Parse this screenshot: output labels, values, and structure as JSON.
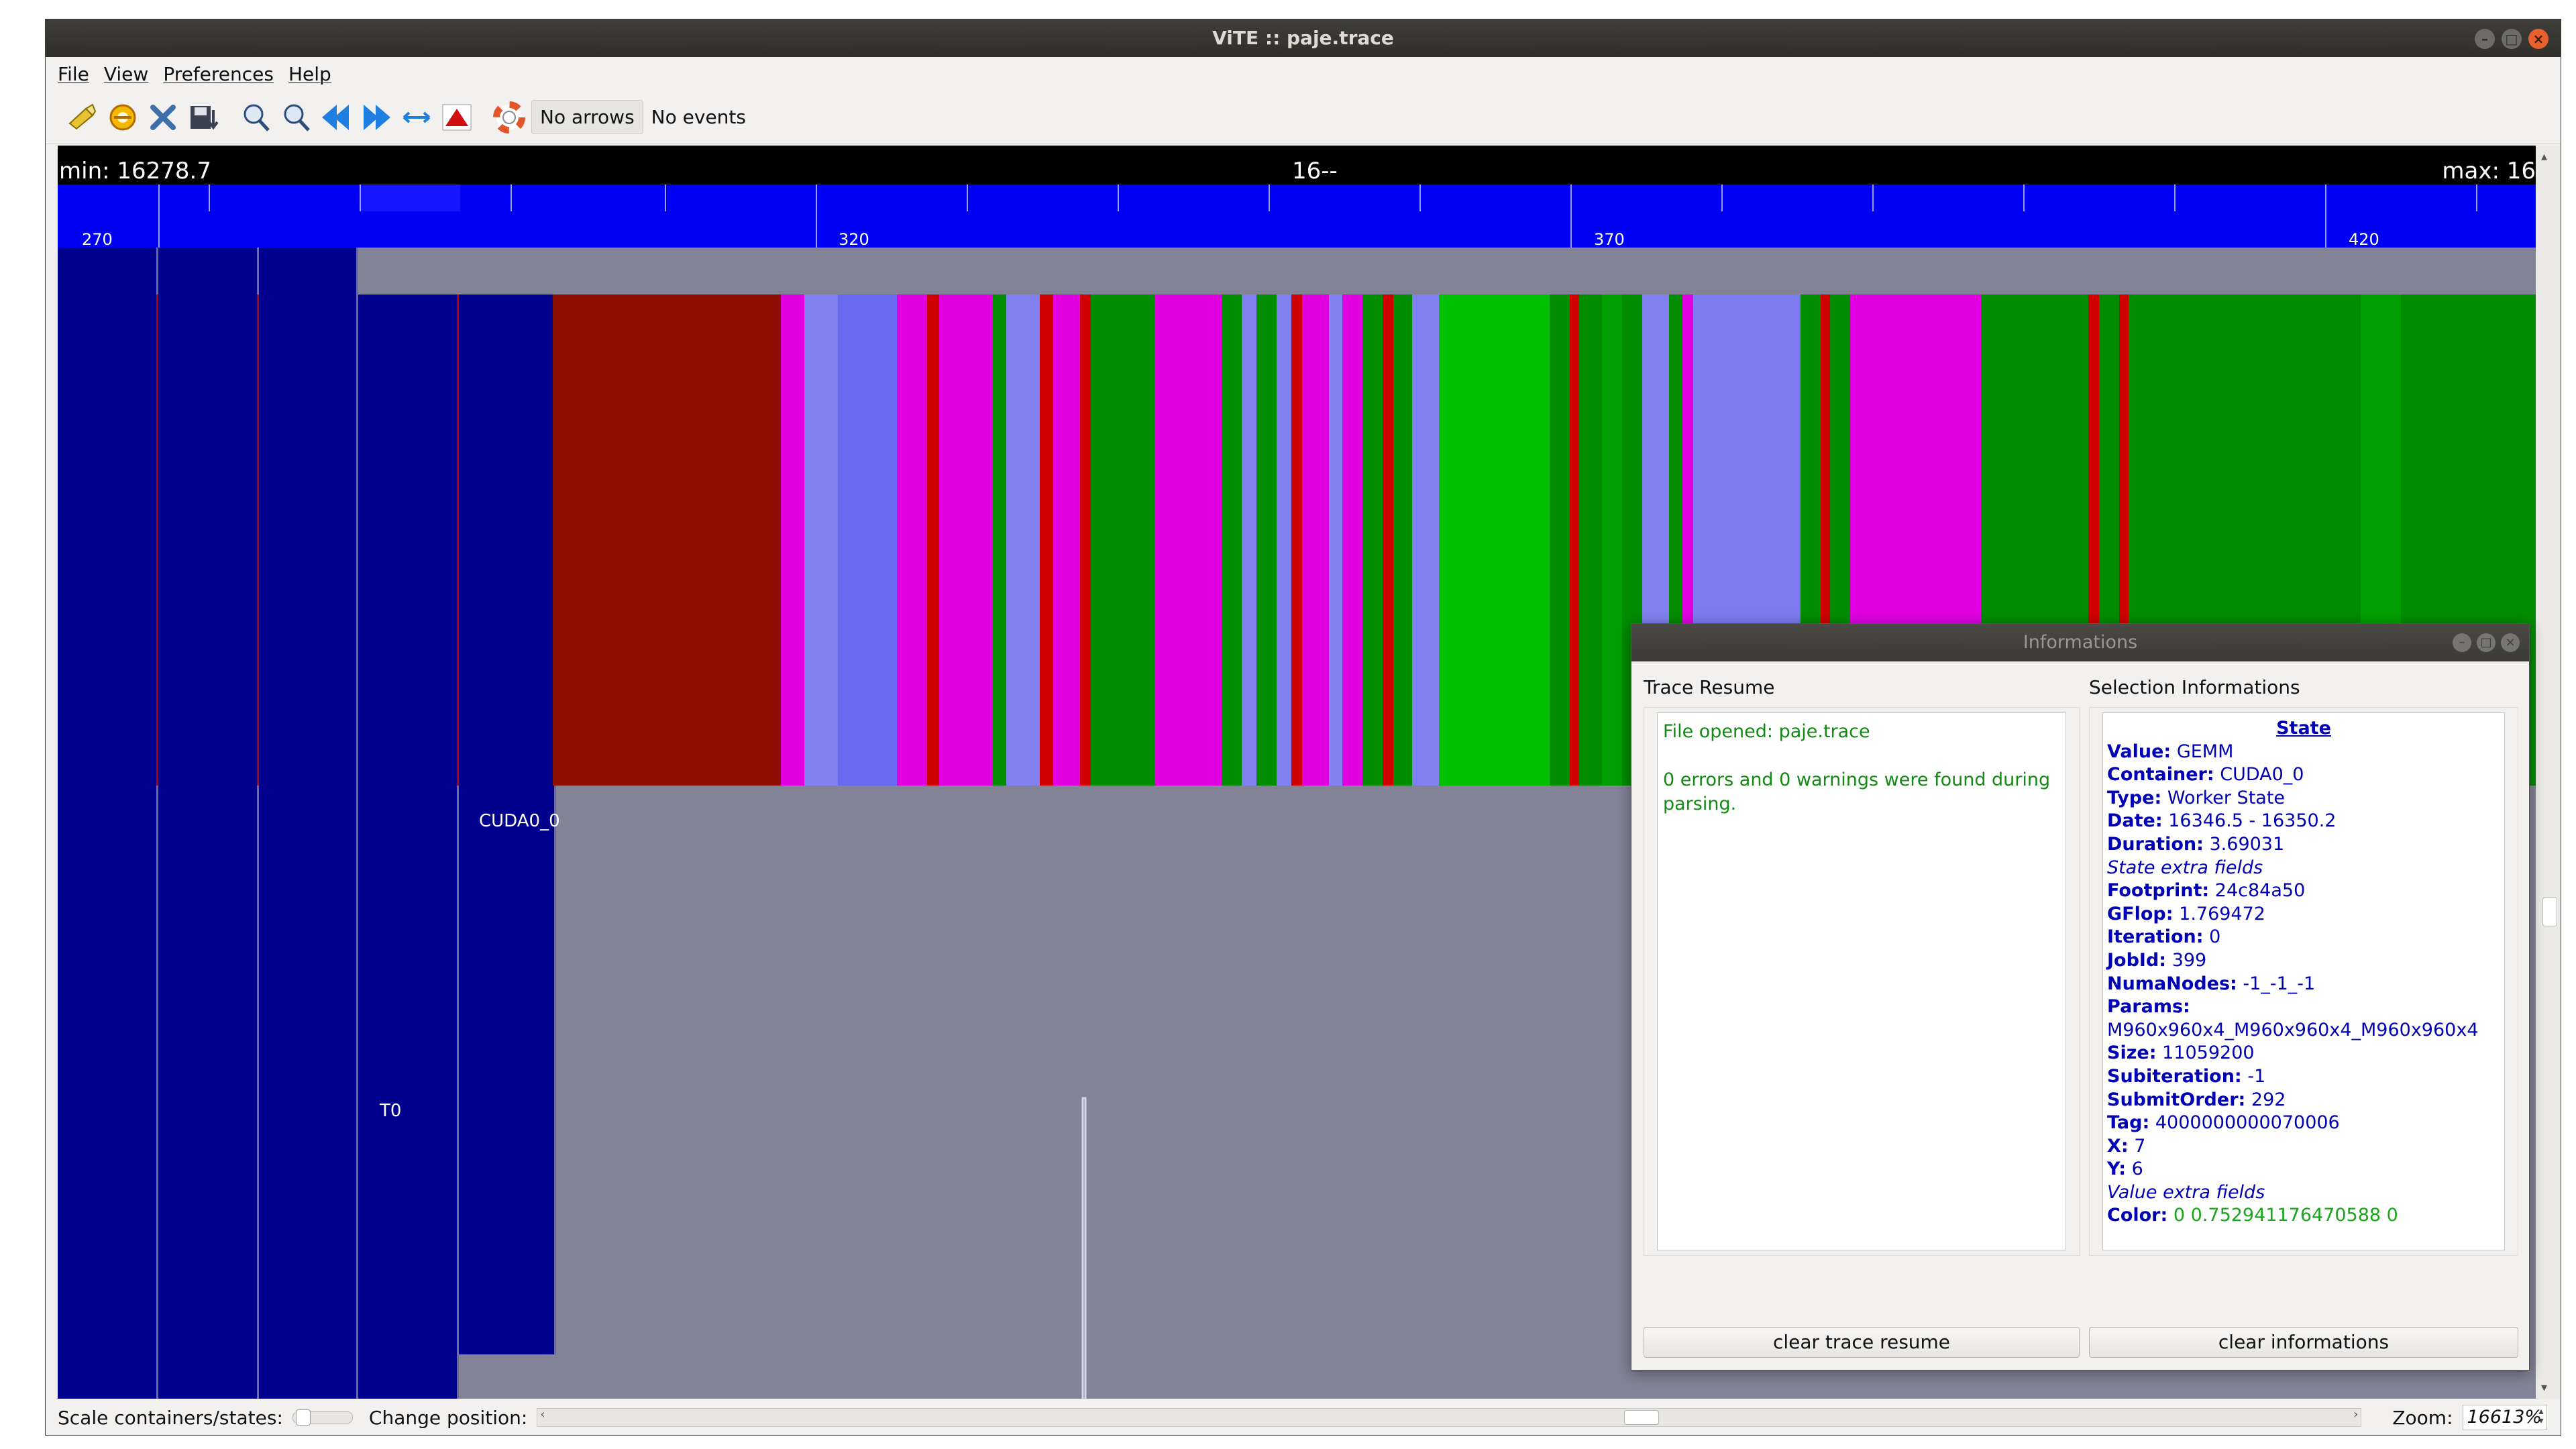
{
  "window": {
    "title": "ViTE :: paje.trace",
    "menu": [
      "File",
      "View",
      "Preferences",
      "Help"
    ]
  },
  "toolbar": {
    "icons": [
      "open-trace-icon",
      "reload-icon",
      "close-icon",
      "export-icon",
      "zoom-in-icon",
      "zoom-out-icon",
      "scroll-left-icon",
      "scroll-right-icon",
      "fit-width-icon",
      "goto-top-icon",
      "help-icon"
    ],
    "arrows_label": "No arrows",
    "events_label": "No events"
  },
  "trace": {
    "min_label": "min: 16278.7",
    "center_label": "16--",
    "max_label": "max: 16",
    "ruler_ticks": [
      "270",
      "320",
      "370",
      "420"
    ],
    "containers": [
      "T0",
      "CUDA0_0"
    ],
    "state_colors": {
      "memory": "#8b0e00",
      "gemm": "#00c000",
      "kernel_a": "#e000e0",
      "kernel_b": "#8080f0",
      "other": "#008c00",
      "red": "#d00000"
    }
  },
  "statusbar": {
    "scale_label": "Scale containers/states:",
    "position_label": "Change position:",
    "zoom_label": "Zoom:",
    "zoom_value": "16613%"
  },
  "dialog": {
    "title": "Informations",
    "trace_resume_header": "Trace Resume",
    "selection_header": "Selection Informations",
    "resume_line1": "File opened: paje.trace",
    "resume_line2": "0 errors and 0 warnings were found during parsing.",
    "clear_resume": "clear trace resume",
    "clear_info": "clear informations",
    "selection": {
      "heading": "State",
      "value_key": "Value:",
      "value": "GEMM",
      "container_key": "Container:",
      "container": "CUDA0_0",
      "type_key": "Type:",
      "type": "Worker State",
      "date_key": "Date:",
      "date": "16346.5 - 16350.2",
      "duration_key": "Duration:",
      "duration": "3.69031",
      "state_extra": "State extra fields",
      "footprint_key": "Footprint:",
      "footprint": "24c84a50",
      "gflop_key": "GFlop:",
      "gflop": "1.769472",
      "iteration_key": "Iteration:",
      "iteration": "0",
      "jobid_key": "JobId:",
      "jobid": "399",
      "numanodes_key": "NumaNodes:",
      "numanodes": "-1_-1_-1",
      "params_key": "Params:",
      "params": "M960x960x4_M960x960x4_M960x960x4",
      "size_key": "Size:",
      "size": "11059200",
      "subiteration_key": "Subiteration:",
      "subiteration": "-1",
      "submitorder_key": "SubmitOrder:",
      "submitorder": "292",
      "tag_key": "Tag:",
      "tag": "4000000000070006",
      "x_key": "X:",
      "x": "7",
      "y_key": "Y:",
      "y": "6",
      "value_extra": "Value extra fields",
      "color_key": "Color:",
      "color": "0 0.752941176470588 0"
    }
  }
}
